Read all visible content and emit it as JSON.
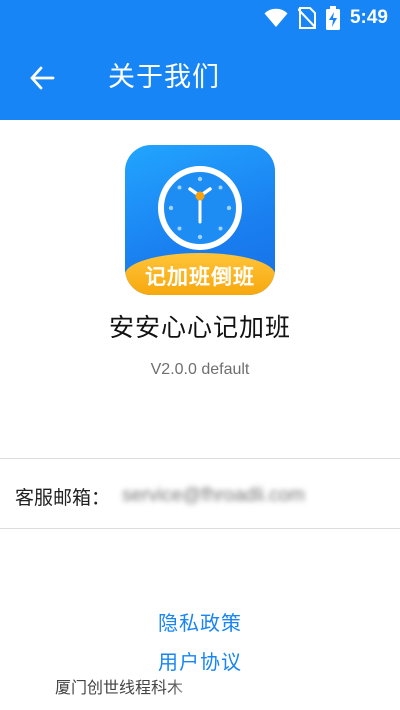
{
  "status_bar": {
    "time": "5:49",
    "icons": [
      "wifi-icon",
      "no-sim-icon",
      "battery-charging-icon"
    ]
  },
  "toolbar": {
    "title": "关于我们",
    "back_icon": "arrow-back-icon",
    "color": "#1785f5"
  },
  "app": {
    "logo_text": "记加班倒班",
    "logo_icon": "clock-icon",
    "name": "安安心心记加班",
    "version": "V2.0.0 default"
  },
  "service": {
    "label": "客服邮箱：",
    "email": "service@fhroadli.com"
  },
  "links": {
    "privacy_policy": "隐私政策",
    "user_agreement": "用户协议"
  },
  "footer": {
    "company": "厦门创世线程科木"
  }
}
